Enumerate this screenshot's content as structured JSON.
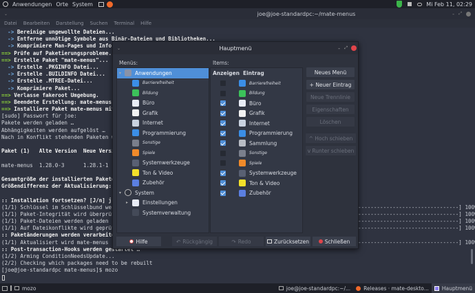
{
  "top_panel": {
    "menus": [
      "Anwendungen",
      "Orte",
      "System"
    ],
    "clock": "Mi Feb 11, 02:29"
  },
  "terminal": {
    "title": "joe@joe-standardpc:~/mate-menus",
    "menu": [
      "Datei",
      "Bearbeiten",
      "Darstellung",
      "Suchen",
      "Terminal",
      "Hilfe"
    ],
    "lines": [
      {
        "p": "  -> ",
        "t": "Bereinige ungewollte Dateien...",
        "s": "bl"
      },
      {
        "p": "  -> ",
        "t": "Entferne unnötige Symbole aus Binär-Dateien und Bibliotheken...",
        "s": "bl"
      },
      {
        "p": "  -> ",
        "t": "Komprimiere Man-Pages und Info-Se",
        "s": "bl"
      },
      {
        "p": "==> ",
        "t": "Prüfe auf Paketierungsprobleme...",
        "s": "g"
      },
      {
        "p": "==> ",
        "t": "Erstelle Paket \"mate-menus\"...",
        "s": "g"
      },
      {
        "p": "  -> ",
        "t": "Erstelle .PKGINFO Datei...",
        "s": "bl"
      },
      {
        "p": "  -> ",
        "t": "Erstelle .BUILDINFO Datei...",
        "s": "bl"
      },
      {
        "p": "  -> ",
        "t": "Erstelle .MTREE-Datei...",
        "s": "bl"
      },
      {
        "p": "  -> ",
        "t": "Komprimiere Paket...",
        "s": "bl"
      },
      {
        "p": "==> ",
        "t": "Verlasse fakeroot Umgebung.",
        "s": "g"
      },
      {
        "p": "==> ",
        "t": "Beendete Erstellung: mate-menus 1.",
        "s": "g"
      },
      {
        "p": "==> ",
        "t": "Installiere Paket mate-menus mit p",
        "s": "g"
      },
      {
        "p": "",
        "t": "[sudo] Passwort für joe:",
        "s": ""
      },
      {
        "p": "",
        "t": "Pakete werden geladen …",
        "s": ""
      },
      {
        "p": "",
        "t": "Abhängigkeiten werden aufgelöst …",
        "s": ""
      },
      {
        "p": "",
        "t": "Nach in Konflikt stehenden Paketen wi",
        "s": ""
      },
      {
        "p": "",
        "t": "",
        "s": ""
      },
      {
        "p": "",
        "t": "Paket (1)   Alte Version  Neue Versio",
        "s": "b"
      },
      {
        "p": "",
        "t": "",
        "s": ""
      },
      {
        "p": "",
        "t": "mate-menus  1.28.0-3      1.28.1-1",
        "s": ""
      },
      {
        "p": "",
        "t": "",
        "s": ""
      },
      {
        "p": "",
        "t": "Gesamtgröße der installierten Pakete:",
        "s": "b"
      },
      {
        "p": "",
        "t": "Größendifferenz der Aktualisierung:",
        "s": "b"
      },
      {
        "p": "",
        "t": "",
        "s": ""
      },
      {
        "p": ":: ",
        "t": "Installation fortsetzen? [J/n] j",
        "s": "b"
      },
      {
        "p": "",
        "t": "(1/1) Schlüssel im Schlüsselbund werde",
        "s": ""
      },
      {
        "p": "",
        "t": "(1/1) Paket-Integrität wird überprüft",
        "s": ""
      },
      {
        "p": "",
        "t": "(1/1) Paket-Dateien werden geladen",
        "s": ""
      },
      {
        "p": "",
        "t": "(1/1) Auf Dateikonflikte wird geprüft",
        "s": ""
      },
      {
        "p": ":: ",
        "t": "Paketänderungen werden verarbeitet",
        "s": "b"
      },
      {
        "p": "",
        "t": "(1/1) Aktualisiert wird mate-menus",
        "s": ""
      },
      {
        "p": ":: ",
        "t": "Post-transaction-Hooks werden gestartet …",
        "s": "b"
      },
      {
        "p": "",
        "t": "(1/2) Arming ConditionNeedsUpdate...",
        "s": ""
      },
      {
        "p": "",
        "t": "(2/2) Checking which packages need to be rebuilt",
        "s": ""
      },
      {
        "p": "",
        "t": "[joe@joe-standardpc mate-menus]$ mozo",
        "s": ""
      }
    ],
    "progress": [
      "--------------------------------] 100%",
      "--------------------------------] 100%",
      "--------------------------------] 100%",
      "--------------------------------] 100%",
      "",
      "--------------------------------] 100%"
    ]
  },
  "taskbar": {
    "items": [
      "mozo",
      "joe@joe-standardpc:~/...",
      "Releases · mate-deskto...",
      "Hauptmenü"
    ]
  },
  "dialog": {
    "title": "Hauptmenü",
    "menus_label": "Menüs:",
    "items_label": "Items:",
    "col_show": "Anzeigen",
    "col_entry": "Eintrag",
    "tree": [
      {
        "label": "Anwendungen",
        "level": 0,
        "exp": "down",
        "icon": "#8a93a8",
        "sel": true
      },
      {
        "label": "Barrierefreiheit",
        "level": 1,
        "icon": "#3b8ee6",
        "small": true
      },
      {
        "label": "Bildung",
        "level": 1,
        "icon": "#3cc25a",
        "small": true
      },
      {
        "label": "Büro",
        "level": 1,
        "icon": "#e8ecf6"
      },
      {
        "label": "Grafik",
        "level": 1,
        "icon": "#f2f2f2"
      },
      {
        "label": "Internet",
        "level": 1,
        "icon": "#c9d2e0"
      },
      {
        "label": "Programmierung",
        "level": 1,
        "icon": "#3b8ee6"
      },
      {
        "label": "Sonstige",
        "level": 1,
        "icon": "#7a7f8c",
        "small": true
      },
      {
        "label": "Spiele",
        "level": 1,
        "icon": "#f08a2a",
        "small": true
      },
      {
        "label": "Systemwerkzeuge",
        "level": 1,
        "icon": "#596073"
      },
      {
        "label": "Ton & Video",
        "level": 1,
        "icon": "#f4e02a"
      },
      {
        "label": "Zubehör",
        "level": 1,
        "icon": "#5b7fe0"
      },
      {
        "label": "System",
        "level": 0,
        "exp": "down",
        "icon": "#2e323d"
      },
      {
        "label": "Einstellungen",
        "level": 1,
        "exp": "right",
        "icon": "#e8ecf6"
      },
      {
        "label": "Systemverwaltung",
        "level": 1,
        "icon": "#444a58"
      }
    ],
    "items": [
      {
        "label": "Barrierefreiheit",
        "on": false,
        "icon": "#3b8ee6",
        "small": true
      },
      {
        "label": "Bildung",
        "on": false,
        "icon": "#3cc25a",
        "small": true
      },
      {
        "label": "Büro",
        "on": true,
        "icon": "#e8ecf6"
      },
      {
        "label": "Grafik",
        "on": true,
        "icon": "#f2f2f2"
      },
      {
        "label": "Internet",
        "on": true,
        "icon": "#c9d2e0"
      },
      {
        "label": "Programmierung",
        "on": true,
        "icon": "#3b8ee6"
      },
      {
        "label": "Sammlung",
        "on": true,
        "icon": "#b8bcc4"
      },
      {
        "label": "Sonstige",
        "on": false,
        "icon": "#7a7f8c",
        "small": true
      },
      {
        "label": "Spiele",
        "on": false,
        "icon": "#f08a2a",
        "small": true
      },
      {
        "label": "Systemwerkzeuge",
        "on": true,
        "icon": "#596073"
      },
      {
        "label": "Ton & Video",
        "on": true,
        "icon": "#f4e02a"
      },
      {
        "label": "Zubehör",
        "on": true,
        "icon": "#5b7fe0"
      }
    ],
    "side_buttons": {
      "new_menu": "Neues Menü",
      "new_entry": "+ Neuer Eintrag",
      "new_separator": "Neue Trennlinie",
      "properties": "Eigenschaften",
      "delete": "Löschen",
      "move_up": "^ Hoch schieben",
      "move_down": "v Runter schieben"
    },
    "bottom_buttons": {
      "help": "Hilfe",
      "undo": "Rückgängig",
      "redo": "Redo",
      "reset": "Zurücksetzen",
      "close": "Schließen"
    }
  }
}
